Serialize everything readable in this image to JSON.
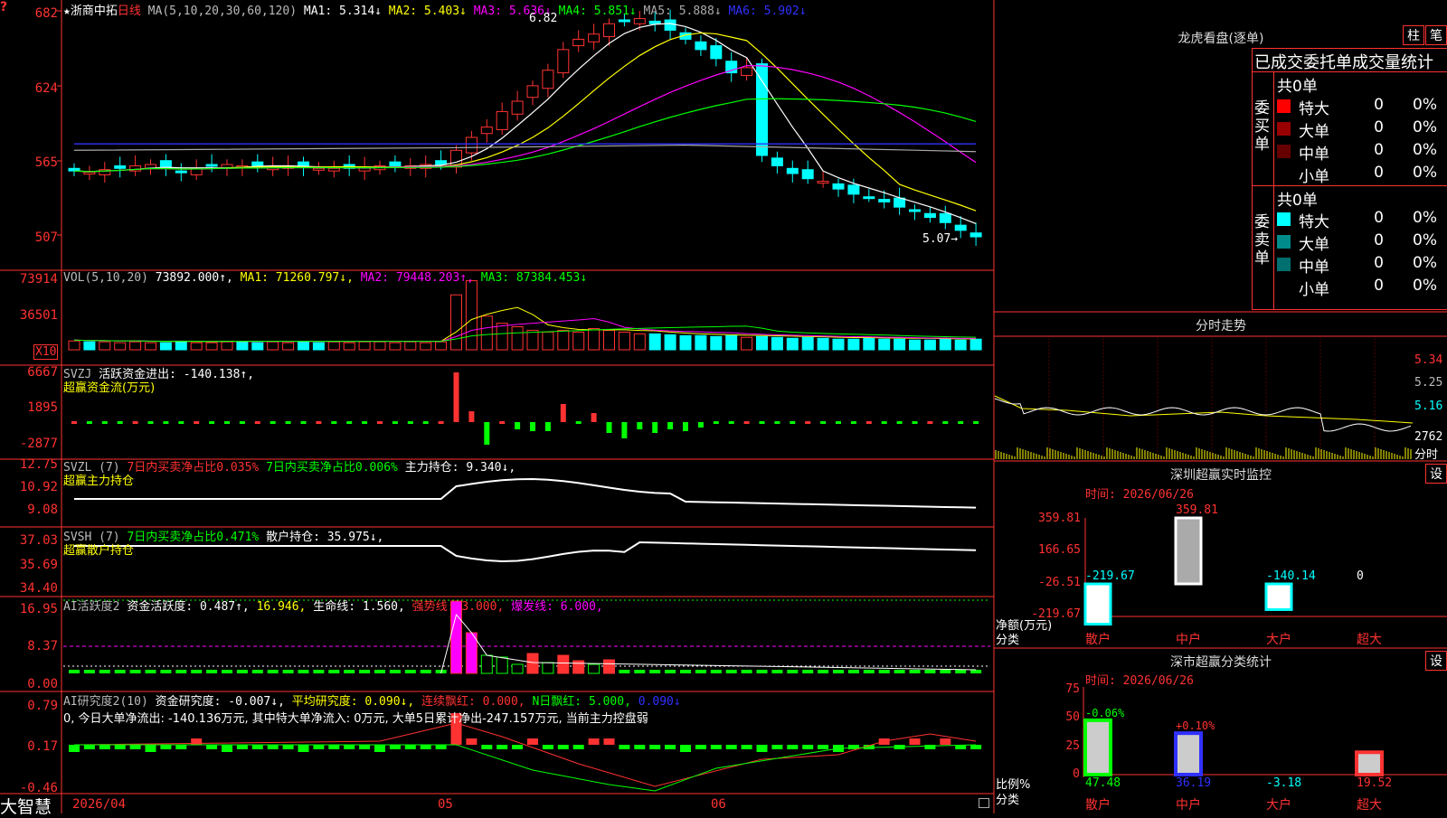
{
  "main": {
    "stock_name": "★浙商中拓",
    "period": "日线",
    "ma_def": "MA(5,10,20,30,60,120)",
    "ma": [
      {
        "label": "MA1:",
        "value": "5.314↓",
        "color": "#ffffff"
      },
      {
        "label": "MA2:",
        "value": "5.403↓",
        "color": "#ffff00"
      },
      {
        "label": "MA3:",
        "value": "5.636↓",
        "color": "#ff00ff"
      },
      {
        "label": "MA4:",
        "value": "5.851↓",
        "color": "#00ff00"
      },
      {
        "label": "MA5:",
        "value": "5.888↓",
        "color": "#aaaaaa"
      },
      {
        "label": "MA6:",
        "value": "5.902↓",
        "color": "#3030ff"
      }
    ],
    "y_ticks": [
      "682",
      "624",
      "565",
      "507"
    ],
    "high_label": "6.82",
    "low_label": "5.07→",
    "up_color": "#ff3232",
    "down_color": "#00ffff"
  },
  "vol": {
    "def": "VOL(5,10,20)",
    "value": "73892.000↑,",
    "ma1": "MA1: 71260.797↓,",
    "ma2": "MA2: 79448.203↑,",
    "ma3": "MA3: 87384.453↓",
    "y_ticks": [
      "73914",
      "36501"
    ],
    "unit": "X10"
  },
  "svzj": {
    "def": "SVZJ",
    "text": "活跃资金进出: -140.138↑,",
    "sub": "超赢资金流(万元)",
    "y_ticks": [
      "6667",
      "1895",
      "-2877"
    ]
  },
  "svzl": {
    "def": "SVZL  (7)",
    "text1": "7日内买卖净占比0.035%",
    "text2": "7日内买卖净占比0.006%",
    "text3": "主力持仓: 9.340↓,",
    "sub": "超赢主力持仓",
    "y_ticks": [
      "12.75",
      "10.92",
      "9.08"
    ]
  },
  "svsh": {
    "def": "SVSH  (7)",
    "text1": "7日内买卖净占比0.471%",
    "text2": "散户持仓: 35.975↓,",
    "sub": "超赢散户持仓",
    "y_ticks": [
      "37.03",
      "35.69",
      "34.40"
    ]
  },
  "ai1": {
    "def": "AI活跃度2",
    "text1": "资金活跃度: 0.487↑,",
    "text2": "16.946,",
    "text3": "生命线: 1.560,",
    "text4": "强势线: 3.000,",
    "text5": "爆发线: 6.000,",
    "y_ticks": [
      "16.95",
      "8.37",
      "0.00"
    ]
  },
  "ai2": {
    "def": "AI研究度2(10)",
    "text1": "资金研究度: -0.007↓,",
    "text2": "平均研究度: 0.090↓,",
    "text3": "连续飘红: 0.000,",
    "text4": "N日飘红: 5.000,",
    "text5": "0.090↓",
    "summary": "0, 今日大单净流出: -140.136万元, 其中特大单净流入: 0万元, 大单5日累计净出-247.157万元, 当前主力控盘弱",
    "y_ticks": [
      "0.79",
      "0.17",
      "-0.46"
    ]
  },
  "bottom": {
    "brand": "大智慧",
    "dates": [
      "2026/04",
      "05",
      "06"
    ]
  },
  "right": {
    "dragon_title": "龙虎看盘(逐单)",
    "btn_bar": "柱",
    "btn_pen": "笔",
    "stats_header": "已成交委托单成交量统计",
    "buy_label": "委买单",
    "sell_label": "委卖单",
    "buy_total": "共0单",
    "sell_total": "共0单",
    "buy_rows": [
      {
        "name": "特大",
        "count": "0",
        "pct": "0%",
        "color": "#ff0000"
      },
      {
        "name": "大单",
        "count": "0",
        "pct": "0%",
        "color": "#990000"
      },
      {
        "name": "中单",
        "count": "0",
        "pct": "0%",
        "color": "#660000"
      },
      {
        "name": "小单",
        "count": "0",
        "pct": "0%",
        "color": ""
      }
    ],
    "sell_rows": [
      {
        "name": "特大",
        "count": "0",
        "pct": "0%",
        "color": "#00ffff"
      },
      {
        "name": "大单",
        "count": "0",
        "pct": "0%",
        "color": "#008b8b"
      },
      {
        "name": "中单",
        "count": "0",
        "pct": "0%",
        "color": "#006f6f"
      },
      {
        "name": "小单",
        "count": "0",
        "pct": "0%",
        "color": ""
      }
    ],
    "intraday_title": "分时走势",
    "intraday_ticks": [
      "5.34",
      "5.25",
      "5.16",
      "2762"
    ],
    "intraday_unit": "分时",
    "sz_title": "深圳超赢实时监控",
    "sz_btn": "设",
    "sz_time": "时间: 2026/06/26",
    "sz_ticks": [
      "359.81",
      "166.65",
      "-26.51",
      "-219.67"
    ],
    "sz_ylabel": "净额(万元)",
    "sz_xlabel": "分类",
    "sz_bars": [
      {
        "cat": "散户",
        "value": -219.67,
        "label": "-219.67"
      },
      {
        "cat": "中户",
        "value": 359.81,
        "label": "359.81"
      },
      {
        "cat": "大户",
        "value": -140.14,
        "label": "-140.14"
      },
      {
        "cat": "超大",
        "value": 0,
        "label": "0"
      }
    ],
    "cls_title": "深市超赢分类统计",
    "cls_btn": "设",
    "cls_time": "时间: 2026/06/26",
    "cls_ticks": [
      "75",
      "50",
      "25",
      "0"
    ],
    "cls_ylabel": "比例%",
    "cls_xlabel": "分类",
    "cls_bars": [
      {
        "cat": "散户",
        "value": 47.48,
        "delta": "-0.06%",
        "label": "47.48"
      },
      {
        "cat": "中户",
        "value": 36.19,
        "delta": "+0.10%",
        "label": "36.19"
      },
      {
        "cat": "大户",
        "value": -3.18,
        "delta": "",
        "label": "-3.18"
      },
      {
        "cat": "超大",
        "value": 19.52,
        "delta": "",
        "label": "19.52"
      }
    ]
  }
}
